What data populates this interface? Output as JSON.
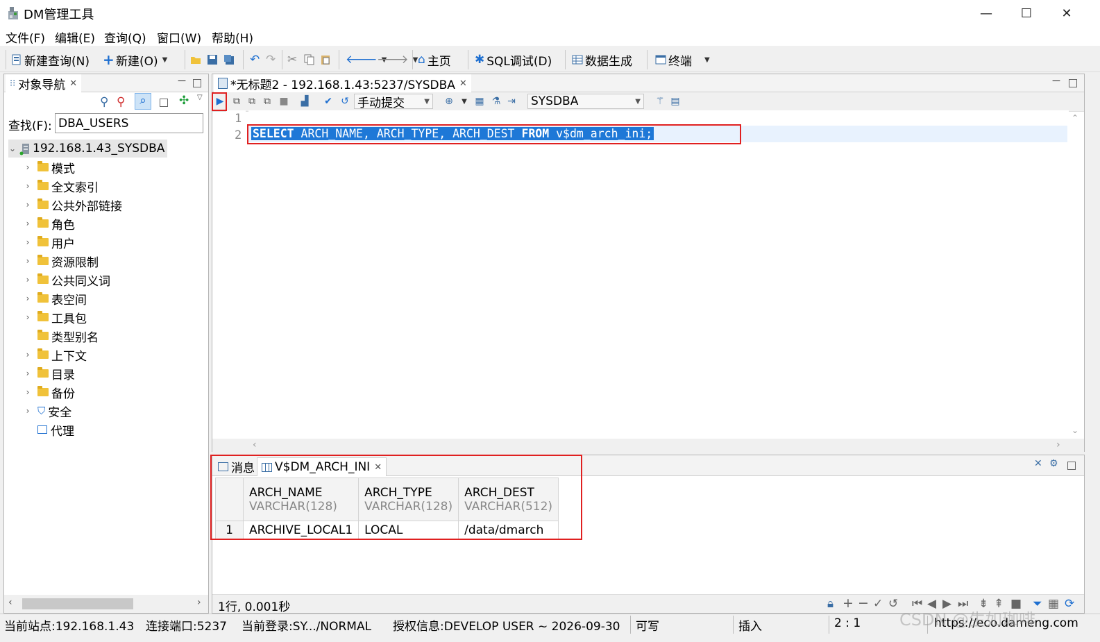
{
  "window": {
    "title": "DM管理工具",
    "minimize": "—",
    "maximize": "☐",
    "close": "✕"
  },
  "menu": [
    "文件(F)",
    "编辑(E)",
    "查询(Q)",
    "窗口(W)",
    "帮助(H)"
  ],
  "toolbar": {
    "new_query": "新建查询(N)",
    "new": "新建(O)",
    "home": "主页",
    "sql_debug": "SQL调试(D)",
    "data_gen": "数据生成",
    "terminal": "终端"
  },
  "nav": {
    "tab_label": "对象导航",
    "search_label": "查找(F):",
    "search_value": "DBA_USERS",
    "root": "192.168.1.43_SYSDBA",
    "items": [
      "模式",
      "全文索引",
      "公共外部链接",
      "角色",
      "用户",
      "资源限制",
      "公共同义词",
      "表空间",
      "工具包",
      "类型别名",
      "上下文",
      "目录",
      "备份",
      "安全",
      "代理"
    ]
  },
  "editor": {
    "tab_label": "*无标题2 - 192.168.1.43:5237/SYSDBA",
    "commit_mode": "手动提交",
    "schema": "SYSDBA",
    "line_numbers": [
      "1",
      "2"
    ],
    "sql_kw1": "SELECT",
    "sql_mid": " ARCH_NAME, ARCH_TYPE, ARCH_DEST ",
    "sql_kw2": "FROM",
    "sql_end": " v$dm_arch_ini;"
  },
  "results": {
    "tab_messages": "消息",
    "tab_result": "V$DM_ARCH_INI",
    "columns": [
      {
        "name": "ARCH_NAME",
        "type": "VARCHAR(128)"
      },
      {
        "name": "ARCH_TYPE",
        "type": "VARCHAR(128)"
      },
      {
        "name": "ARCH_DEST",
        "type": "VARCHAR(512)"
      }
    ],
    "rows": [
      {
        "num": "1",
        "cells": [
          "ARCHIVE_LOCAL1",
          "LOCAL",
          "/data/dmarch"
        ]
      }
    ],
    "status": "1行, 0.001秒"
  },
  "statusbar": {
    "site": "当前站点:192.168.1.43",
    "port": "连接端口:5237",
    "login": "当前登录:SY.../NORMAL",
    "license": "授权信息:DEVELOP USER ~ 2026-09-30",
    "writable": "可写",
    "mode": "插入",
    "position": "2 : 1",
    "url": "https://eco.dameng.com",
    "watermark": "CSDN @生如珈啡"
  }
}
